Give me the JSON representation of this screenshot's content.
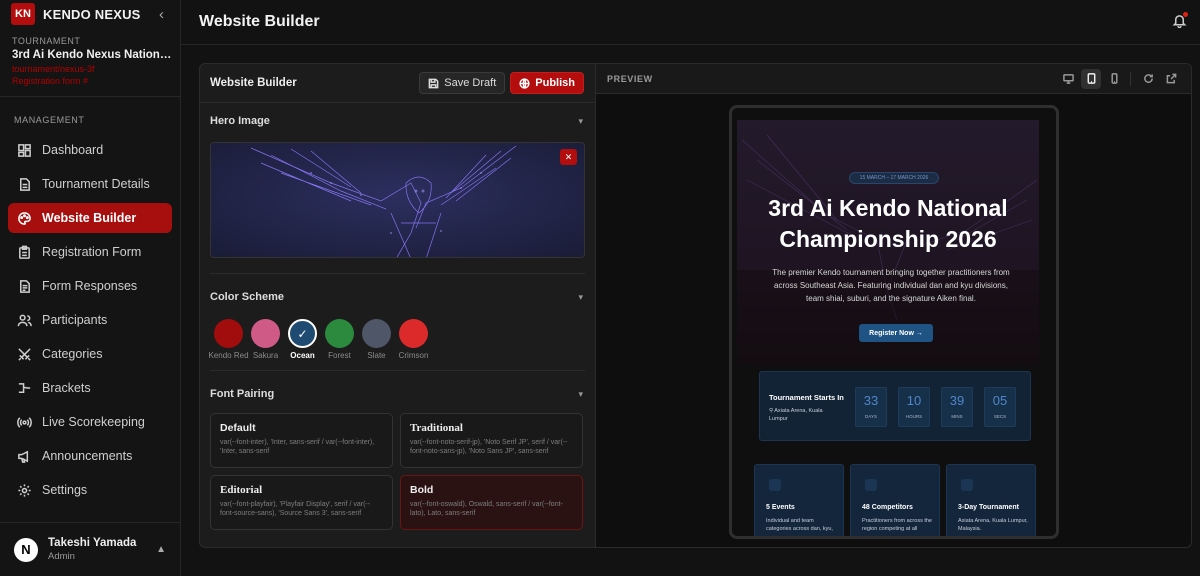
{
  "brand": {
    "logo": "KN",
    "name": "KENDO NEXUS"
  },
  "tournament": {
    "label": "TOURNAMENT",
    "name": "3rd Ai Kendo Nexus National C...",
    "link1": "tournament/nexus-3f",
    "link2": "Registration form #"
  },
  "management_label": "MANAGEMENT",
  "nav": [
    {
      "label": "Dashboard",
      "icon": "dashboard-icon"
    },
    {
      "label": "Tournament Details",
      "icon": "document-icon"
    },
    {
      "label": "Website Builder",
      "icon": "palette-icon"
    },
    {
      "label": "Registration Form",
      "icon": "clipboard-icon"
    },
    {
      "label": "Form Responses",
      "icon": "file-text-icon"
    },
    {
      "label": "Participants",
      "icon": "users-icon"
    },
    {
      "label": "Categories",
      "icon": "swords-icon"
    },
    {
      "label": "Brackets",
      "icon": "bracket-icon"
    },
    {
      "label": "Live Scorekeeping",
      "icon": "radio-icon"
    },
    {
      "label": "Announcements",
      "icon": "megaphone-icon"
    },
    {
      "label": "Settings",
      "icon": "gear-icon"
    }
  ],
  "user": {
    "initial": "N",
    "name": "Takeshi Yamada",
    "role": "Admin"
  },
  "page_title": "Website Builder",
  "editor": {
    "title": "Website Builder",
    "save_label": "Save Draft",
    "publish_label": "Publish",
    "hero_section": "Hero Image",
    "color_section": "Color Scheme",
    "font_section": "Font Pairing"
  },
  "colors": [
    {
      "name": "Kendo Red",
      "hex": "#a10c0c"
    },
    {
      "name": "Sakura",
      "hex": "#cf5a86"
    },
    {
      "name": "Ocean",
      "hex": "#1f4a72"
    },
    {
      "name": "Forest",
      "hex": "#2c8a3f"
    },
    {
      "name": "Slate",
      "hex": "#4e5668"
    },
    {
      "name": "Crimson",
      "hex": "#dc2a2a"
    }
  ],
  "fonts": [
    {
      "name": "Default",
      "desc": "var(--font-inter), 'Inter, sans-serif / var(--font-inter), 'Inter, sans-serif"
    },
    {
      "name": "Traditional",
      "desc": "var(--font-noto-serif-jp), 'Noto Serif JP', serif / var(--font-noto-sans-jp), 'Noto Sans JP', sans-serif"
    },
    {
      "name": "Editorial",
      "desc": "var(--font-playfair), 'Playfair Display', serif / var(--font-source-sans), 'Source Sans 3', sans-serif"
    },
    {
      "name": "Bold",
      "desc": "var(--font-oswald), Oswald, sans-serif / var(--font-lato), Lato, sans-serif"
    }
  ],
  "preview": {
    "label": "PREVIEW",
    "date_pill": "15 MARCH – 17 MARCH 2026",
    "title_line1": "3rd Ai Kendo National",
    "title_line2": "Championship 2026",
    "description": "The premier Kendo tournament bringing together practitioners from across Southeast Asia. Featuring individual dan and kyu divisions, team shiai, suburi, and the signature Aiken final.",
    "register_label": "Register Now →",
    "countdown_title": "Tournament Starts In",
    "countdown_location": "Axiata Arena, Kuala Lumpur",
    "countdown": [
      {
        "value": "33",
        "unit": "DAYS"
      },
      {
        "value": "10",
        "unit": "HOURS"
      },
      {
        "value": "39",
        "unit": "MINS"
      },
      {
        "value": "05",
        "unit": "SECS"
      }
    ],
    "stats": [
      {
        "title": "5 Events",
        "desc": "Individual and team categories across dan, kyu,"
      },
      {
        "title": "48 Competitors",
        "desc": "Practitioners from across the region competing at all"
      },
      {
        "title": "3-Day Tournament",
        "desc": "Axiata Arena, Kuala Lumpur, Malaysia."
      }
    ]
  },
  "accent_color": "#b30d0d"
}
